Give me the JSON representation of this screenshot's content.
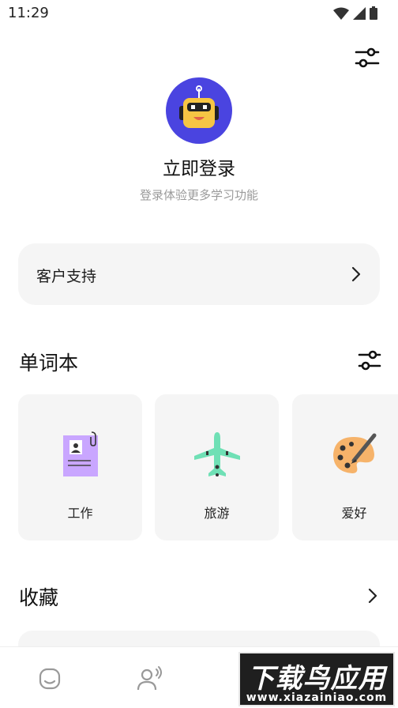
{
  "status_bar": {
    "time": "11:29"
  },
  "profile": {
    "login_title": "立即登录",
    "login_subtitle": "登录体验更多学习功能"
  },
  "support": {
    "label": "客户支持"
  },
  "wordbook": {
    "title": "单词本",
    "cards": [
      {
        "label": "工作",
        "icon": "work-document-icon"
      },
      {
        "label": "旅游",
        "icon": "airplane-icon"
      },
      {
        "label": "爱好",
        "icon": "palette-icon"
      }
    ]
  },
  "favorites": {
    "title": "收藏"
  },
  "watermark": {
    "brand": "下载鸟应用",
    "url": "www.xiazainiao.com"
  },
  "colors": {
    "avatar_bg": "#4a44e0",
    "robot_yellow": "#f6c544",
    "card_bg": "#f5f5f5",
    "airplane_green": "#6fe0b5",
    "doc_purple": "#c9a6ff"
  }
}
